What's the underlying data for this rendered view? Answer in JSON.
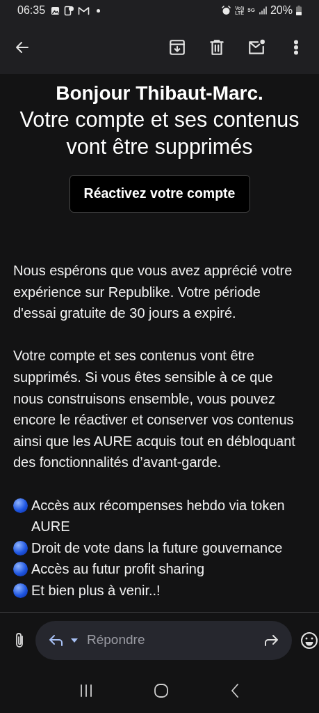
{
  "status_bar": {
    "time": "06:35",
    "volte_top": "Vo))",
    "volte_bottom": "LTE",
    "network": "5G",
    "battery": "20%"
  },
  "toolbar": {
    "actions": [
      {
        "kind": "archive"
      },
      {
        "kind": "delete"
      },
      {
        "kind": "mark_unread"
      },
      {
        "kind": "more"
      }
    ]
  },
  "email": {
    "greeting": "Bonjour Thibaut-Marc.",
    "headline": "Votre compte et ses contenus vont être supprimés",
    "button": "Réactivez votre compte",
    "paragraphs": [
      "Nous espérons que vous avez apprécié votre expérience sur Republike. Votre période d'essai gratuite de 30 jours a expiré.",
      "Votre compte et ses contenus vont être supprimés. Si vous êtes sensible à ce que nous construisons ensemble, vous pouvez encore le réactiver et conserver vos contenus ainsi que les AURE acquis tout en débloquant des fonctionnalités d’avant-garde."
    ],
    "bullets": [
      "Accès aux récompenses hebdo via token AURE",
      "Droit de vote dans la future gouvernance",
      "Accès au futur profit sharing",
      "Et bien plus à venir..!"
    ]
  },
  "reply_bar": {
    "placeholder": "Répondre"
  }
}
